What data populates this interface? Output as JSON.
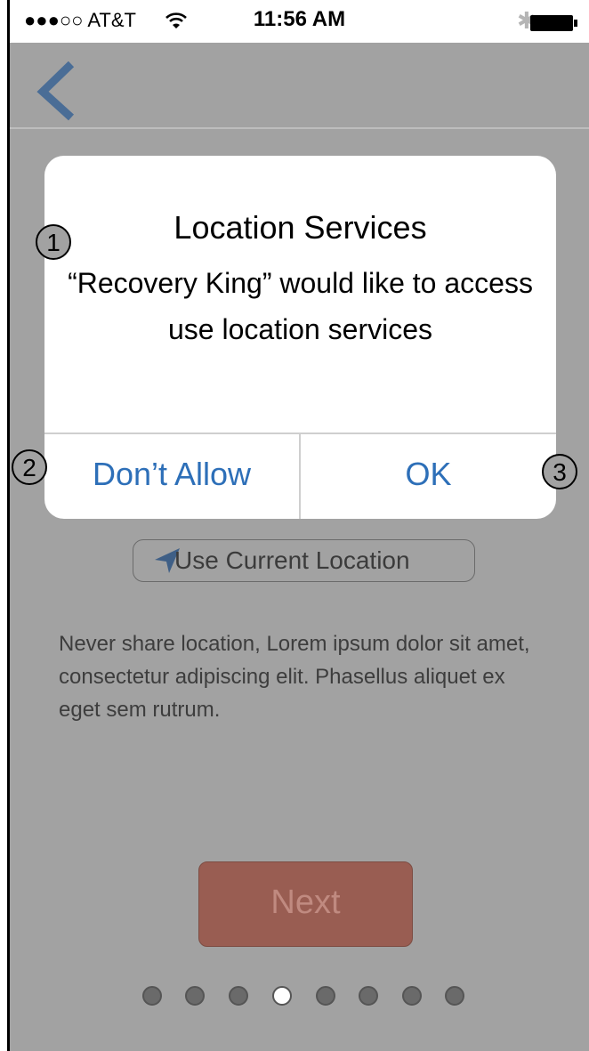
{
  "status_bar": {
    "carrier": "●●●○○ AT&T",
    "time": "11:56 AM",
    "bluetooth_icon": "bluetooth-icon",
    "wifi_icon": "wifi-icon",
    "battery_icon": "battery-icon"
  },
  "nav": {
    "back_icon": "chevron-left-icon"
  },
  "alert": {
    "title": "Location Services",
    "message": "“Recovery King” would like to access use location services",
    "deny_label": "Don’t Allow",
    "ok_label": "OK"
  },
  "use_location": {
    "icon": "location-arrow-icon",
    "label": "Use Current Location"
  },
  "body_text": "Never share location,  Lorem ipsum dolor sit amet, consectetur adipiscing elit. Phasellus aliquet ex eget sem rutrum.",
  "next_button": {
    "label": "Next"
  },
  "pager": {
    "total": 8,
    "current_index": 3
  },
  "callouts": {
    "one": "1",
    "two": "2",
    "three": "3"
  },
  "colors": {
    "accent_blue": "#2d6fb8",
    "back_icon": "#4a6d96",
    "next_button": "#995d52",
    "overlay_gray": "#a2a2a2"
  }
}
